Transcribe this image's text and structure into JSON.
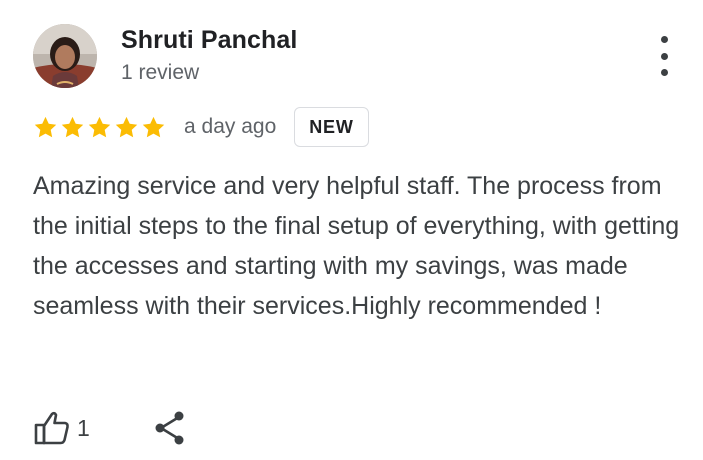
{
  "review": {
    "author": {
      "name": "Shruti Panchal",
      "meta": "1 review",
      "avatar_icon": "profile-photo"
    },
    "rating": {
      "stars": 5,
      "max_stars": 5,
      "star_color": "#fbbc04"
    },
    "date": "a day ago",
    "badge": "NEW",
    "text": "Amazing service and very helpful staff. The process from the initial steps to the final setup of everything, with getting the accesses and starting with my savings, was made seamless with their services.Highly recommended !",
    "actions": {
      "like_count": "1",
      "like_icon": "thumbs-up-outline",
      "share_icon": "share-nodes",
      "more_icon": "more-vertical"
    }
  },
  "colors": {
    "primary_text": "#202124",
    "secondary_text": "#5f6368",
    "body_text": "#3c4043",
    "badge_border": "#dadce0"
  }
}
